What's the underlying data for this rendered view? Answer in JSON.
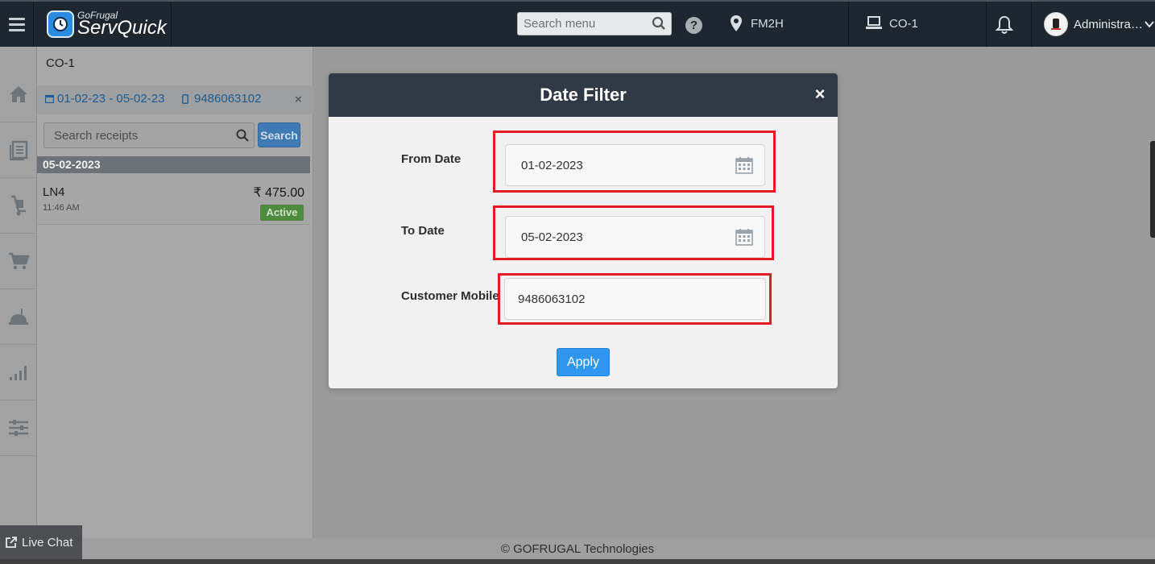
{
  "app": {
    "logo_sub": "GoFrugal",
    "logo_main": "ServQuick",
    "search_placeholder": "Search menu",
    "location": "FM2H",
    "counter": "CO-1",
    "user_name": "Administra…"
  },
  "panel": {
    "title": "CO-1",
    "filter_date": "01-02-23 - 05-02-23",
    "filter_mobile": "9486063102",
    "filter_close": "×",
    "search_placeholder": "Search receipts",
    "search_button": "Search",
    "groups": [
      {
        "date": "05-02-2023",
        "receipts": [
          {
            "id": "LN4",
            "time": "11:46 AM",
            "amount": "₹ 475.00",
            "status": "Active"
          }
        ]
      }
    ]
  },
  "modal": {
    "title": "Date Filter",
    "close": "×",
    "from_label": "From Date",
    "from_value": "01-02-2023",
    "to_label": "To Date",
    "to_value": "05-02-2023",
    "mobile_label": "Customer Mobile",
    "mobile_value": "9486063102",
    "apply_label": "Apply"
  },
  "footer": {
    "copyright": "© GOFRUGAL Technologies",
    "live_chat": "Live Chat"
  },
  "colors": {
    "topbar": "#1e2730",
    "modal_header": "#2f3a46",
    "highlight": "#e01b24",
    "apply_button": "#2f97f0",
    "status_active": "#4f8a3f"
  }
}
